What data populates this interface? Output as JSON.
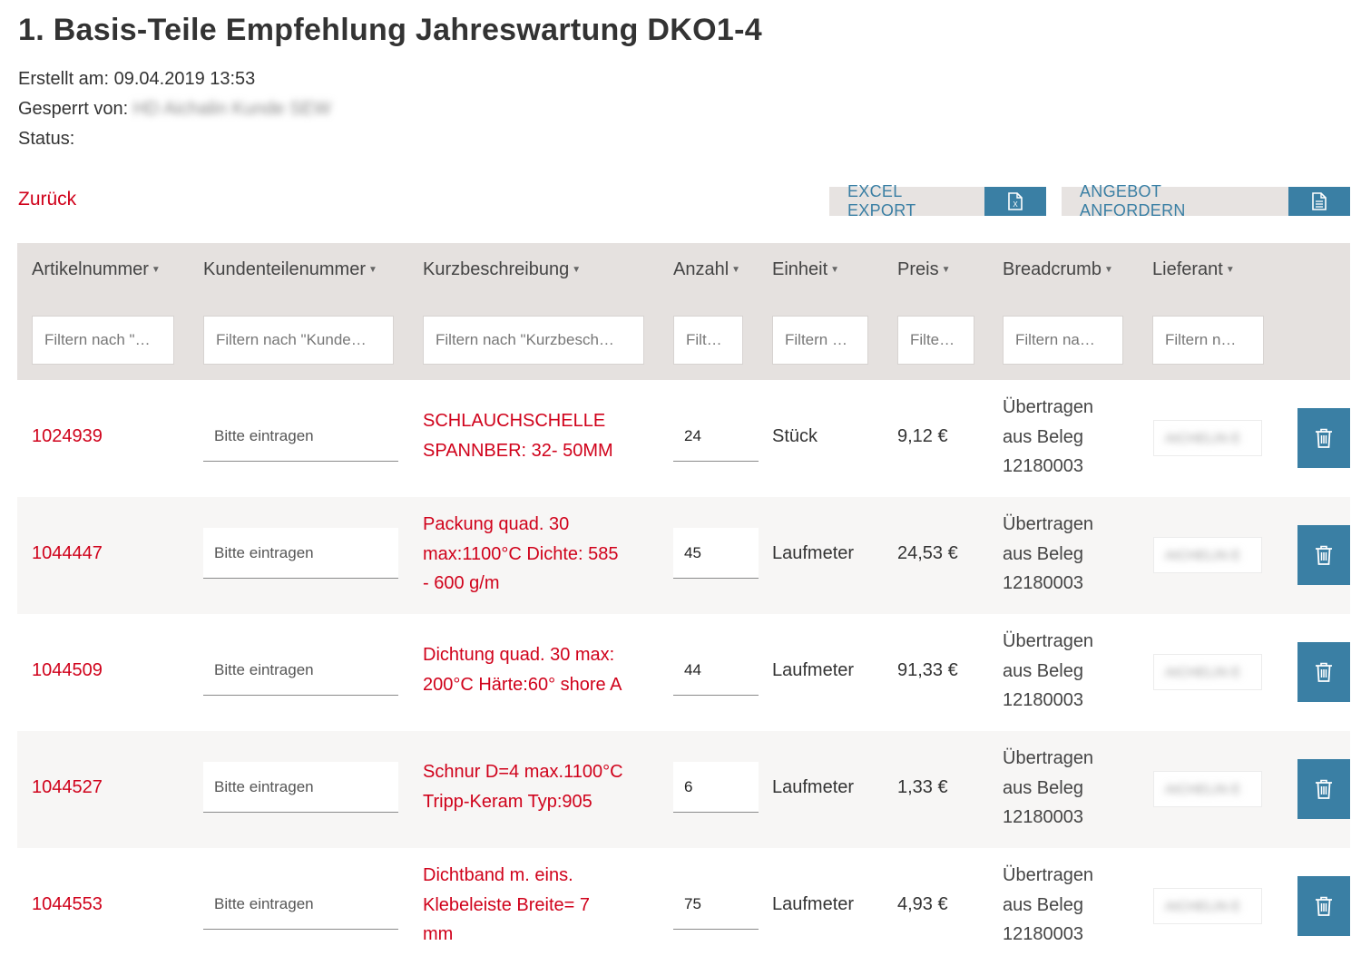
{
  "page": {
    "title": "1. Basis-Teile Empfehlung Jahreswartung DKO1-4",
    "created_label": "Erstellt am:",
    "created_value": "09.04.2019 13:53",
    "locked_label": "Gesperrt von:",
    "locked_value": "HD Aichalin Kunde SEW",
    "status_label": "Status:",
    "back_label": "Zurück"
  },
  "actions": {
    "excel_label": "EXCEL EXPORT",
    "excel_icon": "excel-file-icon",
    "offer_label": "ANGEBOT ANFORDERN",
    "offer_icon": "document-icon"
  },
  "columns": [
    {
      "label": "Artikelnummer",
      "filter_placeholder": "Filtern nach \"…"
    },
    {
      "label": "Kundenteilenummer",
      "filter_placeholder": "Filtern nach \"Kunde…"
    },
    {
      "label": "Kurzbeschreibung",
      "filter_placeholder": "Filtern nach \"Kurzbesch…"
    },
    {
      "label": "Anzahl",
      "filter_placeholder": "Filt…"
    },
    {
      "label": "Einheit",
      "filter_placeholder": "Filtern …"
    },
    {
      "label": "Preis",
      "filter_placeholder": "Filte…"
    },
    {
      "label": "Breadcrumb",
      "filter_placeholder": "Filtern na…"
    },
    {
      "label": "Lieferant",
      "filter_placeholder": "Filtern n…"
    }
  ],
  "rows": [
    {
      "article": "1024939",
      "customer_placeholder": "Bitte eintragen",
      "description": [
        "SCHLAUCHSCHELLE",
        "SPANNBER: 32- 50MM"
      ],
      "quantity": "24",
      "unit": "Stück",
      "price": "9,12 €",
      "breadcrumb": [
        "Übertragen",
        "aus Beleg",
        "12180003"
      ],
      "supplier": "AICHELIN E"
    },
    {
      "article": "1044447",
      "customer_placeholder": "Bitte eintragen",
      "description": [
        "Packung quad. 30",
        "max:1100°C Dichte: 585",
        "- 600 g/m"
      ],
      "quantity": "45",
      "unit": "Laufmeter",
      "price": "24,53 €",
      "breadcrumb": [
        "Übertragen",
        "aus Beleg",
        "12180003"
      ],
      "supplier": "AICHELIN E"
    },
    {
      "article": "1044509",
      "customer_placeholder": "Bitte eintragen",
      "description": [
        "Dichtung quad. 30 max:",
        "200°C Härte:60° shore A"
      ],
      "quantity": "44",
      "unit": "Laufmeter",
      "price": "91,33 €",
      "breadcrumb": [
        "Übertragen",
        "aus Beleg",
        "12180003"
      ],
      "supplier": "AICHELIN E"
    },
    {
      "article": "1044527",
      "customer_placeholder": "Bitte eintragen",
      "description": [
        "Schnur D=4 max.1100°C",
        "Tripp-Keram Typ:905"
      ],
      "quantity": "6",
      "unit": "Laufmeter",
      "price": "1,33 €",
      "breadcrumb": [
        "Übertragen",
        "aus Beleg",
        "12180003"
      ],
      "supplier": "AICHELIN E"
    },
    {
      "article": "1044553",
      "customer_placeholder": "Bitte eintragen",
      "description": [
        "Dichtband m. eins.",
        "Klebeleiste Breite= 7",
        "mm"
      ],
      "quantity": "75",
      "unit": "Laufmeter",
      "price": "4,93 €",
      "breadcrumb": [
        "Übertragen",
        "aus Beleg",
        "12180003"
      ],
      "supplier": "AICHELIN E"
    }
  ],
  "colors": {
    "accent_red": "#d0021b",
    "accent_blue": "#3a7fa4",
    "header_bg": "#e5e1df"
  },
  "icons": {
    "delete": "trash-icon",
    "sort": "caret-down-icon"
  }
}
